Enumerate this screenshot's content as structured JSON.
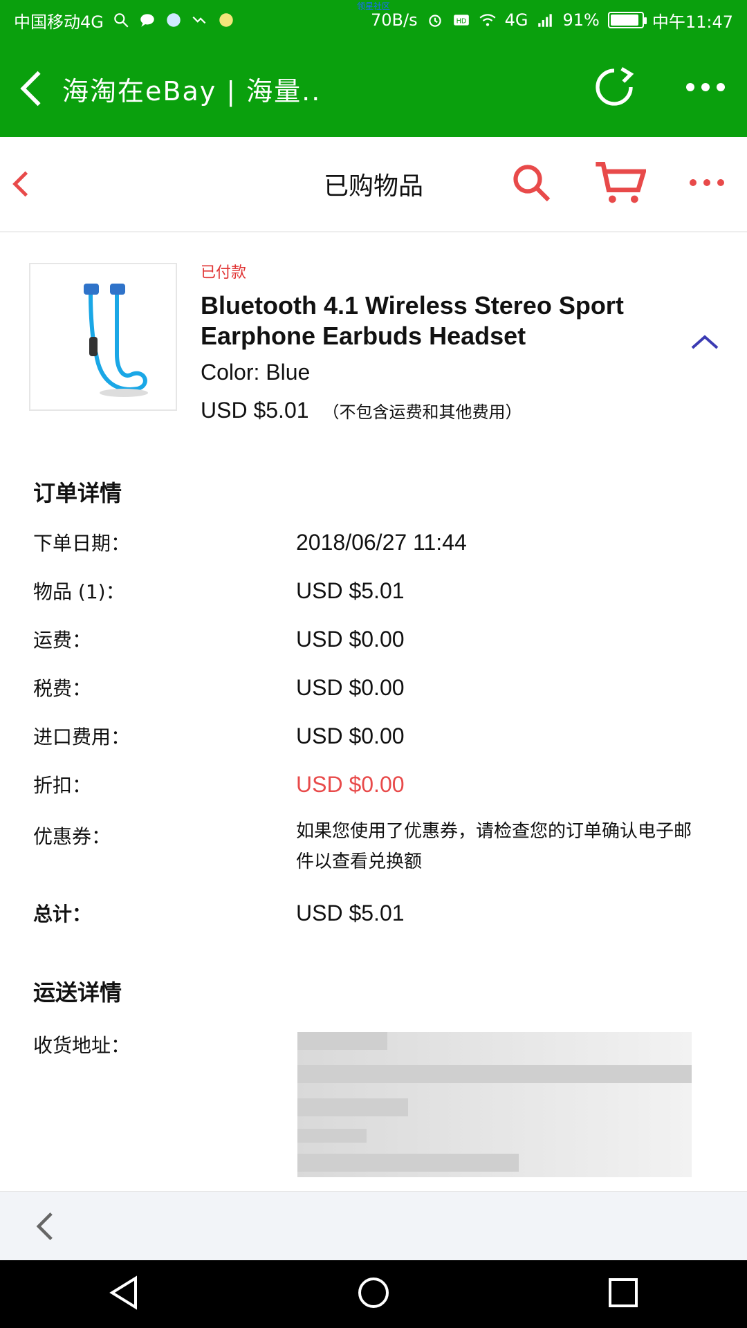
{
  "statusbar": {
    "carrier": "中国移动4G",
    "network_speed": "70B/s",
    "signal_label": "4G",
    "battery_percent": "91%",
    "time": "中午11:47",
    "tiny_banner": "领星社区",
    "battery_level": 0.91
  },
  "appbar": {
    "title": "海淘在eBay | 海量..",
    "back_icon": "back-arrow-icon",
    "refresh_icon": "refresh-icon",
    "more_icon": "more-horizontal-icon"
  },
  "innernav": {
    "title": "已购物品",
    "back_icon": "chevron-left-icon",
    "search_icon": "search-icon",
    "cart_icon": "cart-icon",
    "more_icon": "more-horizontal-icon"
  },
  "product": {
    "status": "已付款",
    "title": "Bluetooth 4.1 Wireless Stereo Sport Earphone Earbuds Headset",
    "color": "Color: Blue",
    "price": "USD $5.01",
    "price_note": "（不包含运费和其他费用）",
    "image_icon": "earphone-image-icon",
    "expand_icon": "chevron-up-icon"
  },
  "order": {
    "title": "订单详情",
    "rows": [
      {
        "label": "下单日期：",
        "value": "2018/06/27 11:44"
      },
      {
        "label": "物品 (1)：",
        "value": "USD $5.01"
      },
      {
        "label": "运费：",
        "value": "USD $0.00"
      },
      {
        "label": "税费：",
        "value": "USD $0.00"
      },
      {
        "label": "进口费用：",
        "value": "USD $0.00"
      },
      {
        "label": "折扣：",
        "value": "USD $0.00"
      }
    ],
    "coupon_label": "优惠券：",
    "coupon_note": "如果您使用了优惠券，请检查您的订单确认电子邮件以查看兑换额",
    "total_label": "总计：",
    "total_value": "USD $5.01"
  },
  "shipping": {
    "title": "运送详情",
    "address_label": "收货地址："
  },
  "bottom": {
    "back_icon": "chevron-left-icon"
  },
  "navbar": {
    "back_icon": "triangle-back-icon",
    "home_icon": "circle-home-icon",
    "recent_icon": "square-recent-icon"
  },
  "colors": {
    "brand_green": "#0aa00d",
    "accent_red": "#e84a4a",
    "expand_purple": "#3b3bb3"
  }
}
